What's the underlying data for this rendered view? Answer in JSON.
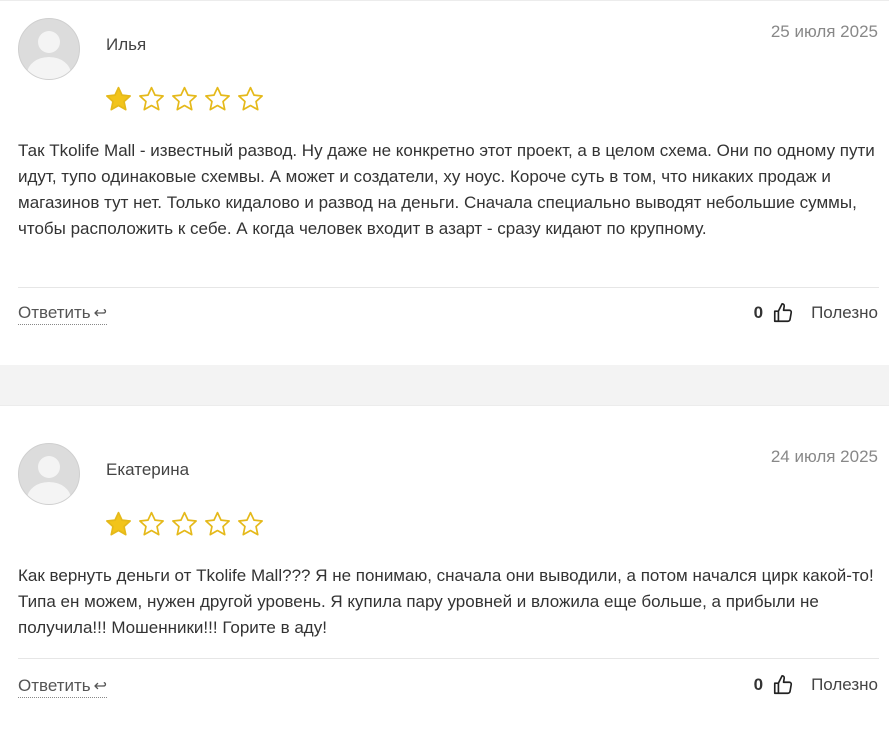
{
  "reviews": [
    {
      "author": "Илья",
      "date": "25 июля 2025",
      "rating": 1,
      "max_rating": 5,
      "text": "Так Tkolife Mall - известный развод. Ну даже не конкретно этот проект, а в целом схема. Они по одному пути идут, тупо одинаковые схемвы. А может и создатели, ху ноус. Короче суть в том, что никаких продаж и магазинов тут нет. Только кидалово и развод на деньги. Сначала специально выводят небольшие суммы, чтобы расположить к себе. А когда человек входит в азарт - сразу кидают по крупному.",
      "reply_label": "Ответить",
      "likes": "0",
      "useful_label": "Полезно"
    },
    {
      "author": "Екатерина",
      "date": "24 июля 2025",
      "rating": 1,
      "max_rating": 5,
      "text": "Как вернуть деньги от Tkolife Mall??? Я не понимаю, сначала они выводили, а потом начался цирк какой-то! Типа ен можем, нужен другой уровень. Я купила пару уровней и вложила еще больше, а прибыли не получила!!! Мошенники!!! Горите в аду!",
      "reply_label": "Ответить",
      "likes": "0",
      "useful_label": "Полезно"
    }
  ],
  "icons": {
    "avatar": "default-user-avatar",
    "star": "star-icon",
    "reply": "reply-arrow-icon",
    "like": "thumbs-up-icon"
  },
  "colors": {
    "star_filled": "#f2c41a",
    "star_stroke": "#e5b91a"
  }
}
